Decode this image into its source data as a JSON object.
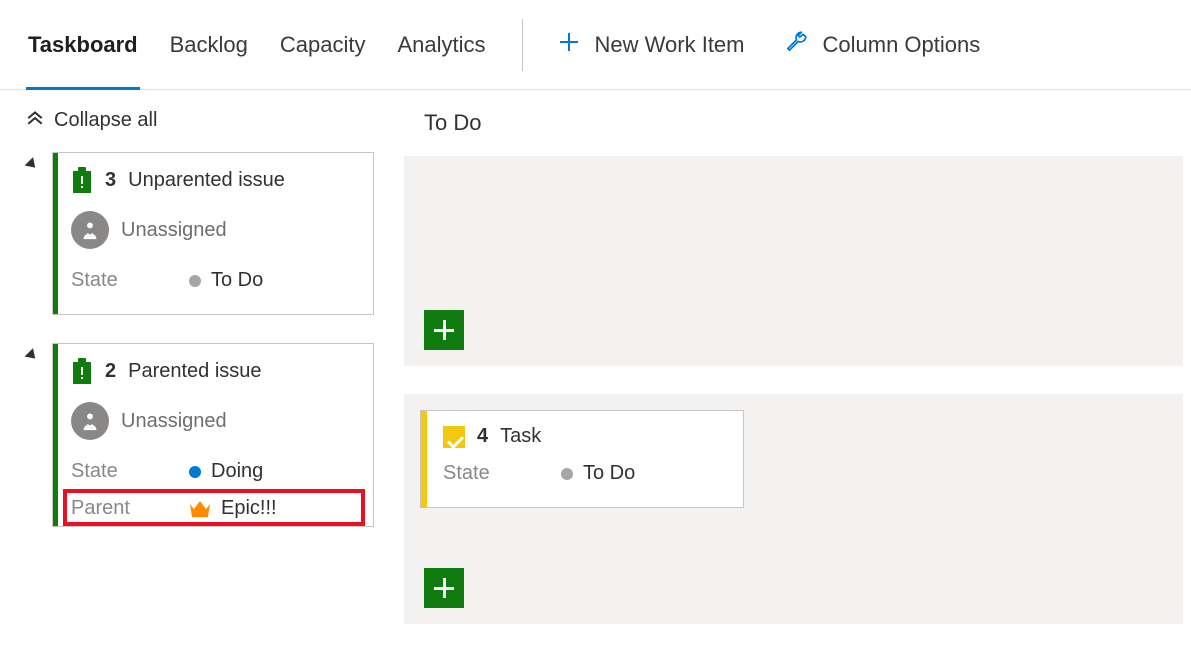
{
  "tabs": {
    "taskboard": "Taskboard",
    "backlog": "Backlog",
    "capacity": "Capacity",
    "analytics": "Analytics"
  },
  "actions": {
    "new_work_item": "New Work Item",
    "column_options": "Column Options"
  },
  "collapse_all": "Collapse all",
  "column_todo": "To Do",
  "assignee_unassigned": "Unassigned",
  "labels": {
    "state": "State",
    "parent": "Parent"
  },
  "states": {
    "todo": "To Do",
    "doing": "Doing"
  },
  "row1": {
    "id": "3",
    "title": "Unparented issue"
  },
  "row2": {
    "id": "2",
    "title": "Parented issue",
    "parent_title": "Epic!!!"
  },
  "task": {
    "id": "4",
    "title": "Task"
  },
  "colors": {
    "green": "#107c10",
    "yellow": "#f2c811",
    "blue": "#0078d4",
    "orange": "#ff8c00"
  }
}
